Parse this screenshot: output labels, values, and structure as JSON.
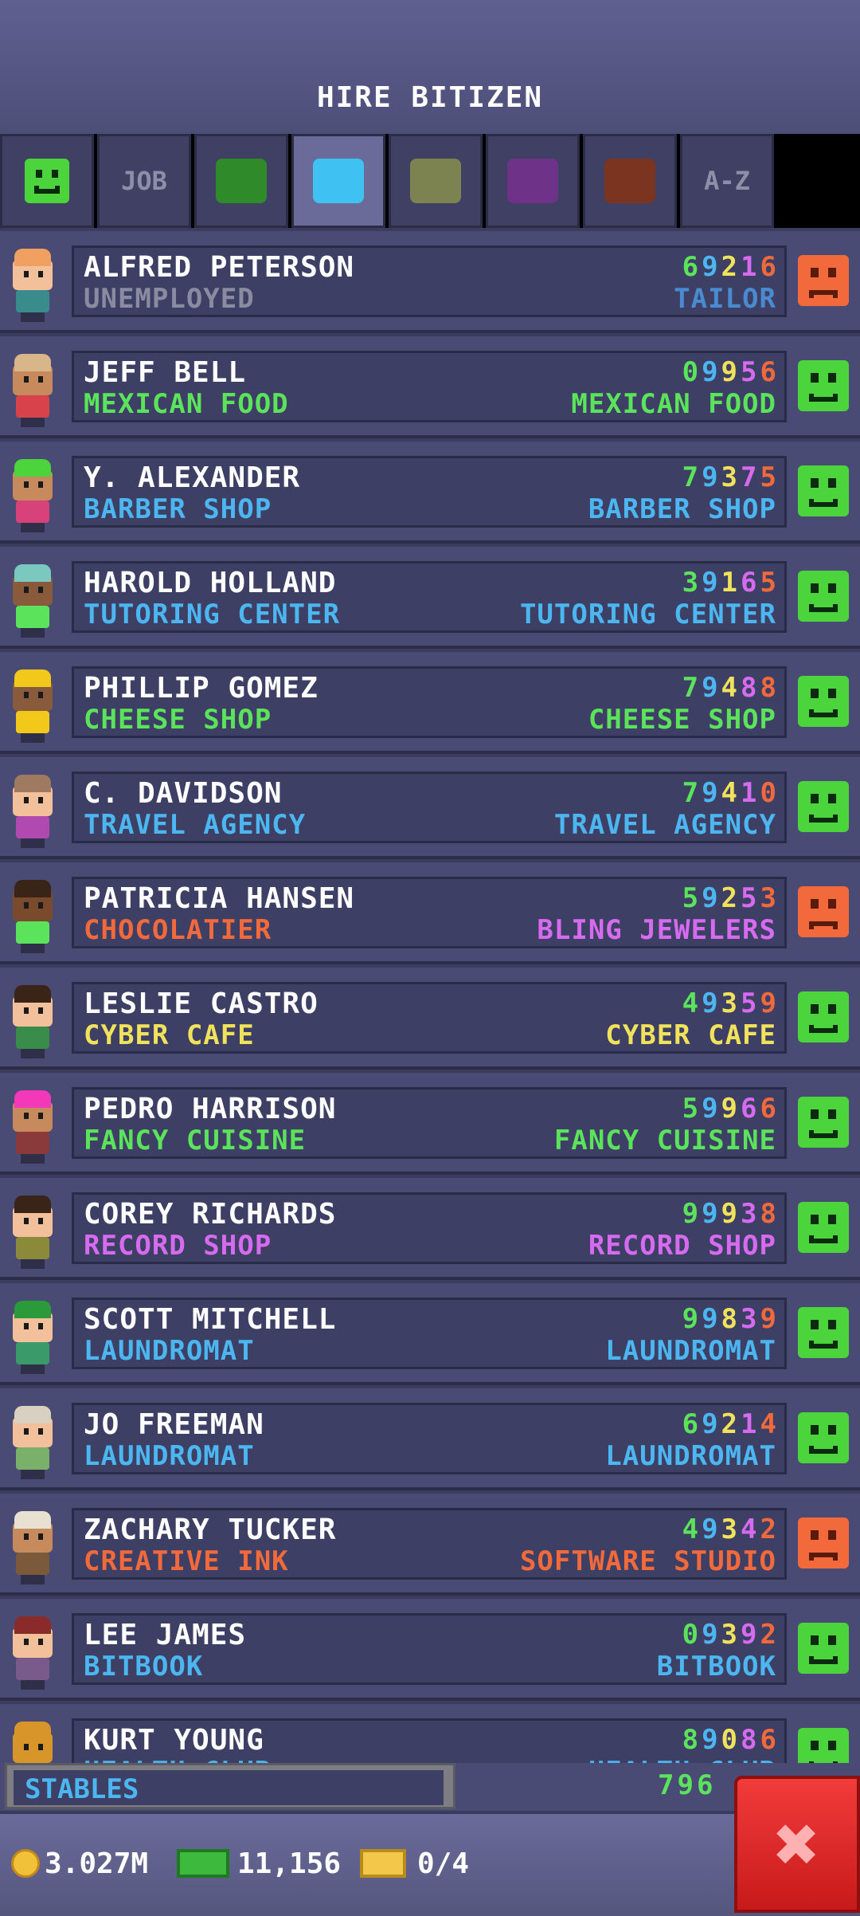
{
  "header": {
    "title": "HIRE BITIZEN"
  },
  "tabs": [
    {
      "id": "happy",
      "icon": "happy-face-icon",
      "color": "#4bd43b"
    },
    {
      "id": "job",
      "label": "JOB"
    },
    {
      "id": "food",
      "icon": "color-swatch-icon",
      "color": "#2f8a2a"
    },
    {
      "id": "service",
      "icon": "color-swatch-icon",
      "color": "#3fc2f2",
      "active": true
    },
    {
      "id": "recreation",
      "icon": "color-swatch-icon",
      "color": "#7d8350"
    },
    {
      "id": "retail",
      "icon": "color-swatch-icon",
      "color": "#6e3288"
    },
    {
      "id": "creative",
      "icon": "color-swatch-icon",
      "color": "#7a341f"
    },
    {
      "id": "az",
      "label": "A-Z"
    }
  ],
  "skill_colors": [
    "#5be35b",
    "#4cb6f0",
    "#f0e35b",
    "#d76bf0",
    "#f26a3c"
  ],
  "bitizens": [
    {
      "name": "ALFRED PETERSON",
      "job": "UNEMPLOYED",
      "job_color": "#8a8aa0",
      "dream": "TAILOR",
      "dream_color": "#4a8ad0",
      "skills": [
        "6",
        "9",
        "2",
        "1",
        "6"
      ],
      "mood": "sad",
      "hair": "#f0a060",
      "skin": "#f2c09a",
      "shirt": "#3a8c8c"
    },
    {
      "name": "JEFF BELL",
      "job": "MEXICAN FOOD",
      "job_color": "#5be35b",
      "dream": "MEXICAN FOOD",
      "dream_color": "#5be35b",
      "skills": [
        "0",
        "9",
        "9",
        "5",
        "6"
      ],
      "mood": "happy",
      "hair": "#d8b68a",
      "skin": "#c78a5c",
      "shirt": "#d8424a"
    },
    {
      "name": "Y. ALEXANDER",
      "job": "BARBER SHOP",
      "job_color": "#4cb6f0",
      "dream": "BARBER SHOP",
      "dream_color": "#4cb6f0",
      "skills": [
        "7",
        "9",
        "3",
        "7",
        "5"
      ],
      "mood": "happy",
      "hair": "#4bd43b",
      "skin": "#c78a5c",
      "shirt": "#d8427a"
    },
    {
      "name": "HAROLD HOLLAND",
      "job": "TUTORING CENTER",
      "job_color": "#4cb6f0",
      "dream": "TUTORING CENTER",
      "dream_color": "#4cb6f0",
      "skills": [
        "3",
        "9",
        "1",
        "6",
        "5"
      ],
      "mood": "happy",
      "hair": "#7ac8c0",
      "skin": "#8a5a3c",
      "shirt": "#5be35b"
    },
    {
      "name": "PHILLIP GOMEZ",
      "job": "CHEESE SHOP",
      "job_color": "#5be35b",
      "dream": "CHEESE SHOP",
      "dream_color": "#5be35b",
      "skills": [
        "7",
        "9",
        "4",
        "8",
        "8"
      ],
      "mood": "happy",
      "hair": "#f2c81a",
      "skin": "#8a5a3c",
      "shirt": "#f2c81a"
    },
    {
      "name": "C. DAVIDSON",
      "job": "TRAVEL AGENCY",
      "job_color": "#4cb6f0",
      "dream": "TRAVEL AGENCY",
      "dream_color": "#4cb6f0",
      "skills": [
        "7",
        "9",
        "4",
        "1",
        "0"
      ],
      "mood": "happy",
      "hair": "#a07a60",
      "skin": "#f2c09a",
      "shirt": "#b04ab0"
    },
    {
      "name": "PATRICIA HANSEN",
      "job": "CHOCOLATIER",
      "job_color": "#f26a3c",
      "dream": "BLING JEWELERS",
      "dream_color": "#d76bf0",
      "skills": [
        "5",
        "9",
        "2",
        "5",
        "3"
      ],
      "mood": "sad",
      "hair": "#3a2418",
      "skin": "#7a4a2c",
      "shirt": "#5be35b"
    },
    {
      "name": "LESLIE CASTRO",
      "job": "CYBER CAFE",
      "job_color": "#f0e35b",
      "dream": "CYBER CAFE",
      "dream_color": "#f0e35b",
      "skills": [
        "4",
        "9",
        "3",
        "5",
        "9"
      ],
      "mood": "happy",
      "hair": "#3a2418",
      "skin": "#f2c09a",
      "shirt": "#3a8c4a"
    },
    {
      "name": "PEDRO HARRISON",
      "job": "FANCY CUISINE",
      "job_color": "#5be35b",
      "dream": "FANCY CUISINE",
      "dream_color": "#5be35b",
      "skills": [
        "5",
        "9",
        "9",
        "6",
        "6"
      ],
      "mood": "happy",
      "hair": "#f23ab8",
      "skin": "#c78a5c",
      "shirt": "#8a3a3a"
    },
    {
      "name": "COREY RICHARDS",
      "job": "RECORD SHOP",
      "job_color": "#d76bf0",
      "dream": "RECORD SHOP",
      "dream_color": "#d76bf0",
      "skills": [
        "9",
        "9",
        "9",
        "3",
        "8"
      ],
      "mood": "happy",
      "hair": "#3a2418",
      "skin": "#f2c09a",
      "shirt": "#8a8a3a"
    },
    {
      "name": "SCOTT MITCHELL",
      "job": "LAUNDROMAT",
      "job_color": "#4cb6f0",
      "dream": "LAUNDROMAT",
      "dream_color": "#4cb6f0",
      "skills": [
        "9",
        "9",
        "8",
        "3",
        "9"
      ],
      "mood": "happy",
      "hair": "#2a9a3a",
      "skin": "#f2c09a",
      "shirt": "#3a9a6a"
    },
    {
      "name": "JO FREEMAN",
      "job": "LAUNDROMAT",
      "job_color": "#4cb6f0",
      "dream": "LAUNDROMAT",
      "dream_color": "#4cb6f0",
      "skills": [
        "6",
        "9",
        "2",
        "1",
        "4"
      ],
      "mood": "happy",
      "hair": "#d8d0c0",
      "skin": "#f2c09a",
      "shirt": "#7ab06a"
    },
    {
      "name": "ZACHARY TUCKER",
      "job": "CREATIVE INK",
      "job_color": "#f26a3c",
      "dream": "SOFTWARE STUDIO",
      "dream_color": "#f26a3c",
      "skills": [
        "4",
        "9",
        "3",
        "4",
        "2"
      ],
      "mood": "sad",
      "hair": "#e8e0d0",
      "skin": "#c78a5c",
      "shirt": "#7a5a3a"
    },
    {
      "name": "LEE JAMES",
      "job": "BITBOOK",
      "job_color": "#4cb6f0",
      "dream": "BITBOOK",
      "dream_color": "#4cb6f0",
      "skills": [
        "0",
        "9",
        "3",
        "9",
        "2"
      ],
      "mood": "happy",
      "hair": "#8a2a2a",
      "skin": "#f2c09a",
      "shirt": "#7a5a8a"
    },
    {
      "name": "KURT YOUNG",
      "job": "HEALTH CLUB",
      "job_color": "#4cb6f0",
      "dream": "HEALTH CLUB",
      "dream_color": "#4cb6f0",
      "skills": [
        "8",
        "9",
        "0",
        "8",
        "6"
      ],
      "mood": "happy",
      "hair": "#d8962a",
      "skin": "#d8962a",
      "shirt": "#5be35b"
    }
  ],
  "partial_row": {
    "shop": "STABLES",
    "skills_visible": "796"
  },
  "footer": {
    "coins": "3.027M",
    "bux": "11,156",
    "vip": "0/4"
  },
  "close_label": "✖"
}
